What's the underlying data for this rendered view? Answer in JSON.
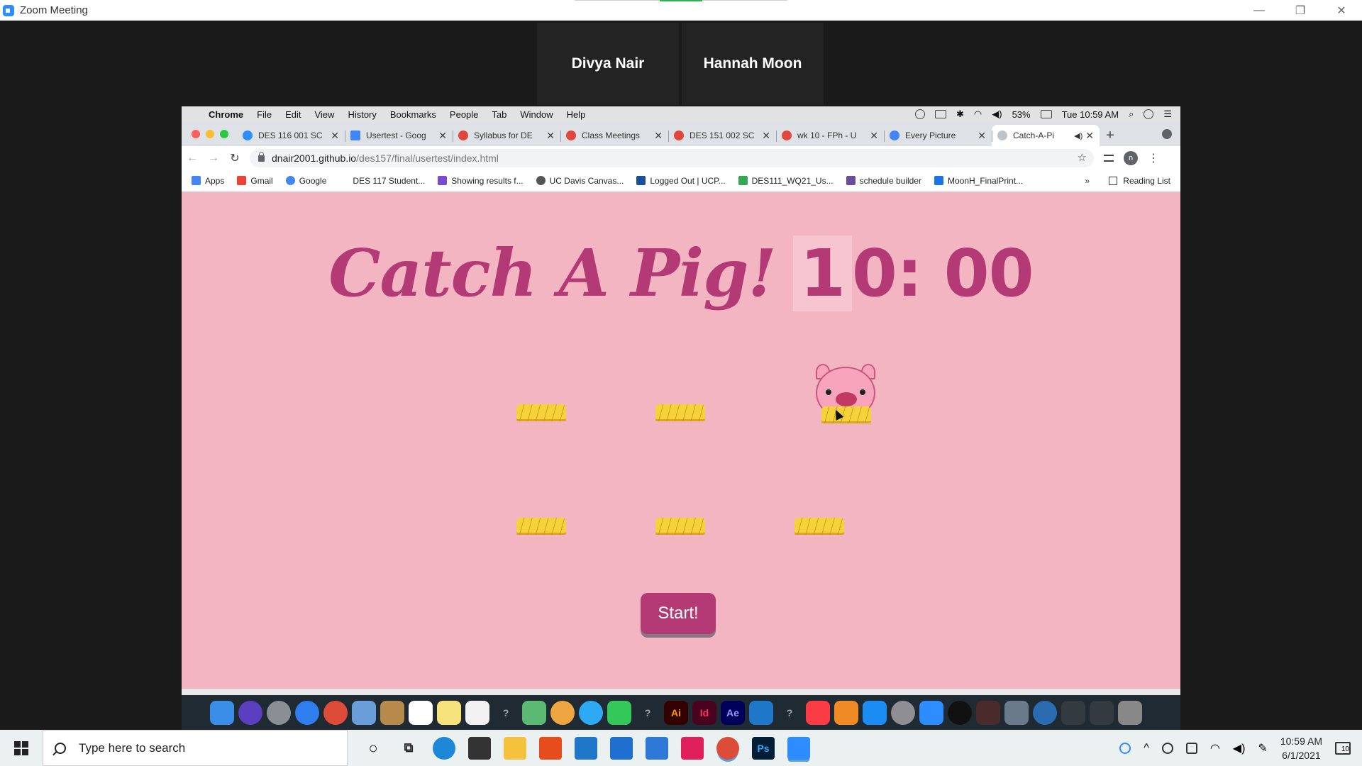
{
  "zoom": {
    "window_title": "Zoom Meeting",
    "participants": [
      "Divya Nair",
      "Hannah Moon"
    ]
  },
  "mac_menubar": {
    "app": "Chrome",
    "menus": [
      "File",
      "Edit",
      "View",
      "History",
      "Bookmarks",
      "People",
      "Tab",
      "Window",
      "Help"
    ],
    "battery": "53%",
    "datetime": "Tue 10:59 AM"
  },
  "browser": {
    "tabs": [
      {
        "label": "DES 116 001 SC",
        "color": "#2d8cff"
      },
      {
        "label": "Usertest - Goog",
        "color": "#4285f4"
      },
      {
        "label": "Syllabus for DE",
        "color": "#e0483e"
      },
      {
        "label": "Class Meetings",
        "color": "#e0483e"
      },
      {
        "label": "DES 151 002 SC",
        "color": "#e0483e"
      },
      {
        "label": "wk 10 - FPh - U",
        "color": "#e0483e"
      },
      {
        "label": "Every Picture",
        "color": "#4285f4"
      },
      {
        "label": "Catch-A-Pi",
        "color": "#9aa0a6"
      }
    ],
    "url_host": "dnair2001.github.io",
    "url_path": "/des157/final/usertest/index.html",
    "profile_initial": "n",
    "bookmarks": [
      {
        "label": "Apps",
        "color": "#4285f4"
      },
      {
        "label": "Gmail",
        "color": "#ea4335"
      },
      {
        "label": "Google",
        "color": "#4285f4"
      },
      {
        "label": "DES 117 Student...",
        "color": "#ffffff"
      },
      {
        "label": "Showing results f...",
        "color": "#7a4bd1"
      },
      {
        "label": "UC Davis Canvas...",
        "color": "#555555"
      },
      {
        "label": "Logged Out | UCP...",
        "color": "#1a4f9c"
      },
      {
        "label": "DES111_WQ21_Us...",
        "color": "#34a853"
      },
      {
        "label": "schedule builder",
        "color": "#6a4c9c"
      },
      {
        "label": "MoonH_FinalPrint...",
        "color": "#1a73e8"
      }
    ],
    "reading_list": "Reading List"
  },
  "game": {
    "title": "Catch A Pig!",
    "timer_highlight": "1",
    "timer_rest": "0: 00",
    "start_label": "Start!"
  },
  "dock": {
    "app_labels": [
      "Ai",
      "Id",
      "Ae"
    ]
  },
  "taskbar": {
    "search_placeholder": "Type here to search",
    "ps_label": "Ps",
    "time": "10:59 AM",
    "date": "6/1/2021",
    "notifications": "10"
  }
}
